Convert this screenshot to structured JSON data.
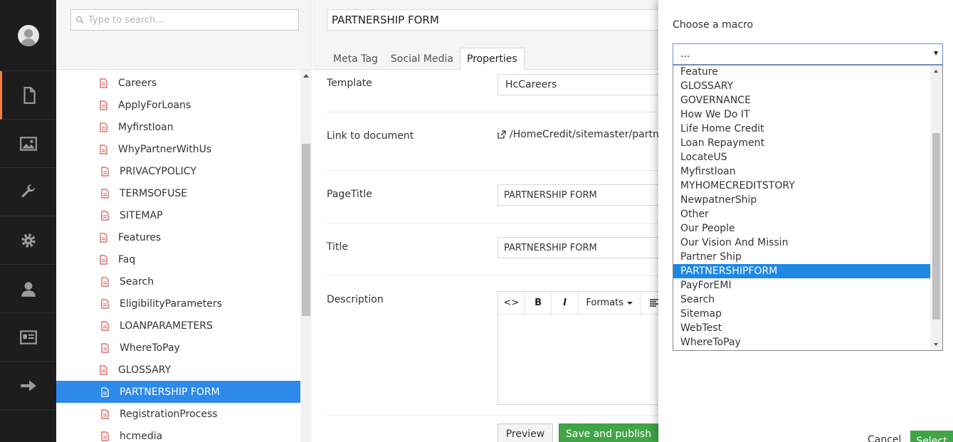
{
  "tree": {
    "search_placeholder": "Type to search...",
    "items": [
      {
        "label": "Careers"
      },
      {
        "label": "ApplyForLoans"
      },
      {
        "label": "Myfirstloan"
      },
      {
        "label": "WhyPartnerWithUs"
      },
      {
        "label": "PRIVACYPOLICY"
      },
      {
        "label": "TERMSOFUSE"
      },
      {
        "label": "SITEMAP"
      },
      {
        "label": "Features"
      },
      {
        "label": "Faq"
      },
      {
        "label": "Search"
      },
      {
        "label": "EligibilityParameters"
      },
      {
        "label": "LOANPARAMETERS"
      },
      {
        "label": "WhereToPay"
      },
      {
        "label": "GLOSSARY"
      },
      {
        "label": "PARTNERSHIP FORM"
      },
      {
        "label": "RegistrationProcess"
      },
      {
        "label": "hcmedia"
      }
    ],
    "selected_index": 14
  },
  "editor": {
    "node_name": "PARTNERSHIP FORM",
    "tabs": [
      "Meta Tag",
      "Social Media",
      "Properties"
    ],
    "active_tab": "Properties",
    "template_label": "Template",
    "template_value": "HcCareers",
    "link_label": "Link to document",
    "link_value": "/HomeCredit/sitemaster/partne",
    "pagetitle_label": "PageTitle",
    "pagetitle_value": "PARTNERSHIP FORM",
    "title_label": "Title",
    "title_value": "PARTNERSHIP FORM",
    "description_label": "Description",
    "rte_code": "<>",
    "rte_bold": "B",
    "rte_italic": "I",
    "rte_formats": "Formats",
    "preview_label": "Preview",
    "publish_label": "Save and publish"
  },
  "macro": {
    "title": "Choose a macro",
    "selected_value": "...",
    "options": [
      "Feature",
      "GLOSSARY",
      "GOVERNANCE",
      "How We Do IT",
      "Life Home Credit",
      "Loan Repayment",
      "LocateUS",
      "Myfirstloan",
      "MYHOMECREDITSTORY",
      "NewpatnerShip",
      "Other",
      "Our People",
      "Our Vision And Missin",
      "Partner Ship",
      "PARTNERSHIPFORM",
      "PayForEMI",
      "Search",
      "Sitemap",
      "WebTest",
      "WhereToPay"
    ],
    "highlighted_index": 14,
    "cancel_label": "Cancel",
    "select_label": "Select"
  },
  "colors": {
    "nav_bg": "#1d1d1d",
    "nav_active_accent": "#f47e3e",
    "selection_blue": "#2e8aea",
    "publish_green": "#41a447"
  }
}
